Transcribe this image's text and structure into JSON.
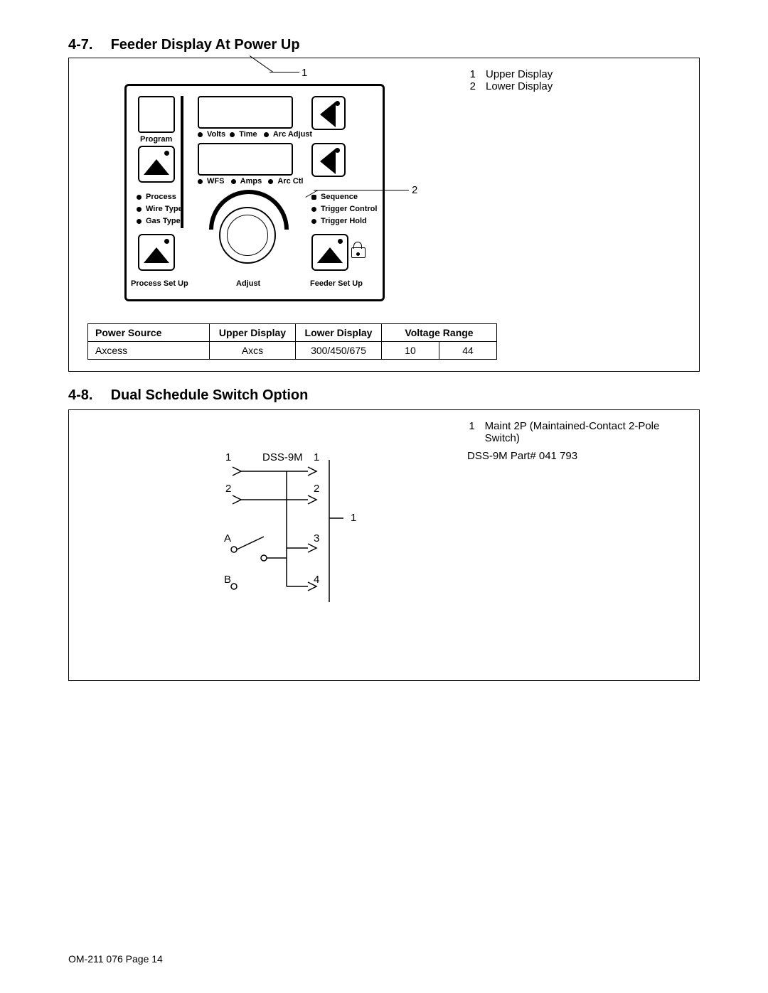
{
  "section47": {
    "number": "4-7.",
    "title": "Feeder Display At Power Up",
    "legend": [
      {
        "n": "1",
        "text": "Upper Display"
      },
      {
        "n": "2",
        "text": "Lower Display"
      }
    ],
    "callout1": "1",
    "callout2": "2",
    "panel": {
      "program": "Program",
      "volts": "Volts",
      "time": "Time",
      "arc_adjust": "Arc Adjust",
      "wfs": "WFS",
      "amps": "Amps",
      "arc_ctl": "Arc Ctl",
      "process": "Process",
      "wire_type": "Wire Type",
      "gas_type": "Gas Type",
      "sequence": "Sequence",
      "trigger_control": "Trigger Control",
      "trigger_hold": "Trigger Hold",
      "process_setup": "Process Set Up",
      "adjust": "Adjust",
      "feeder_setup": "Feeder Set Up"
    },
    "table": {
      "headers": {
        "ps": "Power Source",
        "ud": "Upper Display",
        "ld": "Lower Display",
        "vr": "Voltage Range"
      },
      "row": {
        "ps": "Axcess",
        "ud": "Axcs",
        "ld": "300/450/675",
        "v1": "10",
        "v2": "44"
      }
    }
  },
  "section48": {
    "number": "4-8.",
    "title": "Dual Schedule Switch Option",
    "legend_n": "1",
    "legend_text": "Maint 2P (Maintained-Contact 2-Pole Switch)",
    "part": "DSS-9M Part# 041 793",
    "schematic": {
      "label": "DSS-9M",
      "l1": "1",
      "r1": "1",
      "l2": "2",
      "r2": "2",
      "lA": "A",
      "r3": "3",
      "lB": "B",
      "r4": "4",
      "callout": "1"
    }
  },
  "footer": "OM-211 076 Page 14"
}
